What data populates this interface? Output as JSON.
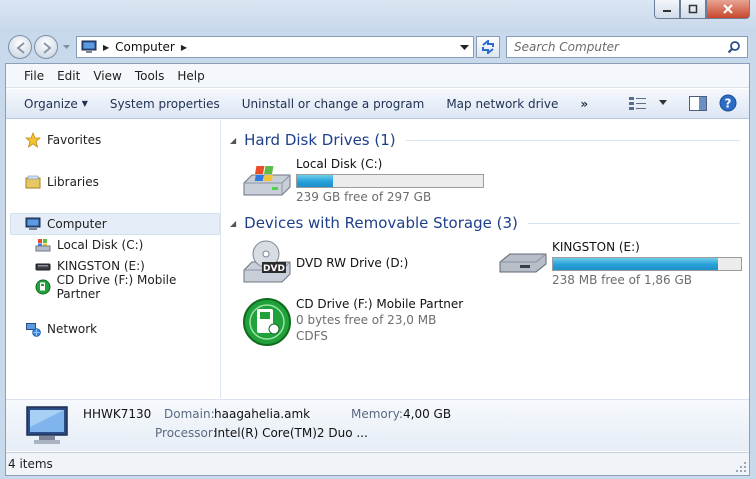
{
  "window": {
    "minimize_icon": "minimize-icon",
    "maximize_icon": "maximize-icon",
    "close_icon": "close-icon"
  },
  "address": {
    "breadcrumb": "Computer",
    "search_placeholder": "Search Computer"
  },
  "menu": {
    "file": "File",
    "edit": "Edit",
    "view": "View",
    "tools": "Tools",
    "help": "Help"
  },
  "toolbar": {
    "organize": "Organize",
    "system_properties": "System properties",
    "uninstall": "Uninstall or change a program",
    "map_drive": "Map network drive",
    "more": "»"
  },
  "nav": {
    "favorites": "Favorites",
    "libraries": "Libraries",
    "computer": "Computer",
    "local_disk": "Local Disk (C:)",
    "kingston": "KINGSTON (E:)",
    "cd_drive": "CD Drive (F:) Mobile Partner",
    "network": "Network"
  },
  "groups": {
    "hdd": "Hard Disk Drives (1)",
    "removable": "Devices with Removable Storage (3)"
  },
  "drives": {
    "c": {
      "name": "Local Disk (C:)",
      "free_text": "239 GB free of 297 GB",
      "used_fraction": 0.195
    },
    "d": {
      "name": "DVD RW Drive (D:)"
    },
    "e": {
      "name": "KINGSTON (E:)",
      "free_text": "238 MB free of 1,86 GB",
      "used_fraction": 0.875
    },
    "f": {
      "name": "CD Drive (F:) Mobile Partner",
      "free_text": "0 bytes free of 23,0 MB",
      "fs": "CDFS"
    }
  },
  "details": {
    "computer_name": "HHWK7130",
    "domain_label": "Domain:",
    "domain_value": "haagahelia.amk",
    "memory_label": "Memory:",
    "memory_value": "4,00 GB",
    "processor_label": "Processor:",
    "processor_value": "Intel(R) Core(TM)2 Duo ..."
  },
  "status": {
    "items": "4 items"
  },
  "colors": {
    "accent_bar": "#26a0da",
    "group_title": "#1e3f8a",
    "close_button": "#c8462c"
  }
}
